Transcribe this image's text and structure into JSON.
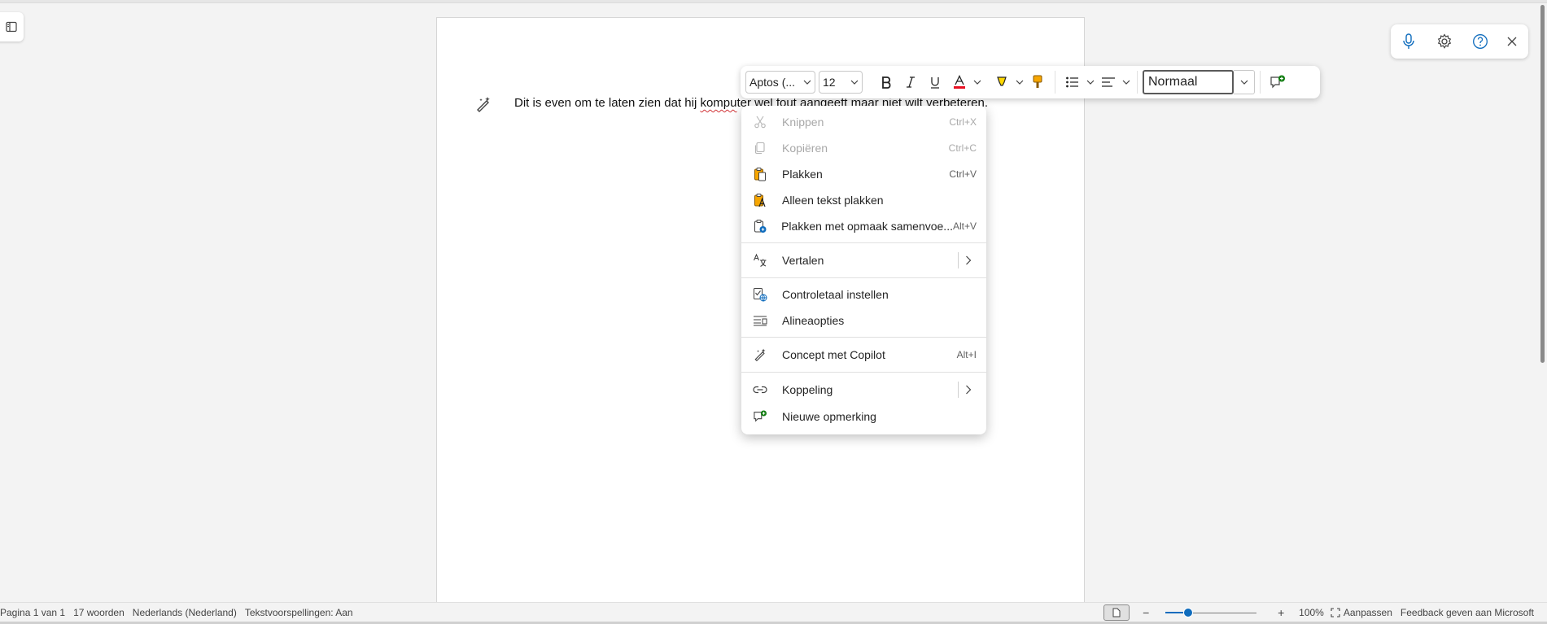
{
  "document": {
    "text_before": "Dit is even om te laten zien dat hij ",
    "misspelled_word": "kompu",
    "text_after": "ter wel fout aangeeft maar niet wilt verbeteren."
  },
  "toolbar": {
    "font_name": "Aptos (...",
    "font_size": "12",
    "style_value": "Normaal",
    "font_color": "#e81123",
    "highlight_color": "#ffd800"
  },
  "context_menu": {
    "items": [
      {
        "label": "Knippen",
        "shortcut": "Ctrl+X",
        "icon": "scissors-icon",
        "disabled": true
      },
      {
        "label": "Kopiëren",
        "shortcut": "Ctrl+C",
        "icon": "copy-icon",
        "disabled": true
      },
      {
        "label": "Plakken",
        "shortcut": "Ctrl+V",
        "icon": "paste-icon",
        "disabled": false
      },
      {
        "label": "Alleen tekst plakken",
        "shortcut": "",
        "icon": "paste-text-only-icon",
        "disabled": false
      },
      {
        "label": "Plakken met opmaak samenvoe...",
        "shortcut": "Alt+V",
        "icon": "paste-merge-icon",
        "disabled": false
      },
      {
        "label": "Vertalen",
        "shortcut": "",
        "icon": "translate-icon",
        "disabled": false,
        "submenu": true
      },
      {
        "label": "Controletaal instellen",
        "shortcut": "",
        "icon": "proofing-language-icon",
        "disabled": false
      },
      {
        "label": "Alineaopties",
        "shortcut": "",
        "icon": "paragraph-options-icon",
        "disabled": false
      },
      {
        "label": "Concept met Copilot",
        "shortcut": "Alt+I",
        "icon": "copilot-draft-icon",
        "disabled": false
      },
      {
        "label": "Koppeling",
        "shortcut": "",
        "icon": "link-icon",
        "disabled": false,
        "submenu": true
      },
      {
        "label": "Nieuwe opmerking",
        "shortcut": "",
        "icon": "new-comment-icon",
        "disabled": false
      }
    ]
  },
  "statusbar": {
    "page": "Pagina 1 van 1",
    "words": "17 woorden",
    "language": "Nederlands (Nederland)",
    "predictions": "Tekstvoorspellingen: Aan",
    "zoom_level": "100%",
    "zoom_fraction": 0.25,
    "fit": "Aanpassen",
    "feedback": "Feedback geven aan Microsoft"
  }
}
